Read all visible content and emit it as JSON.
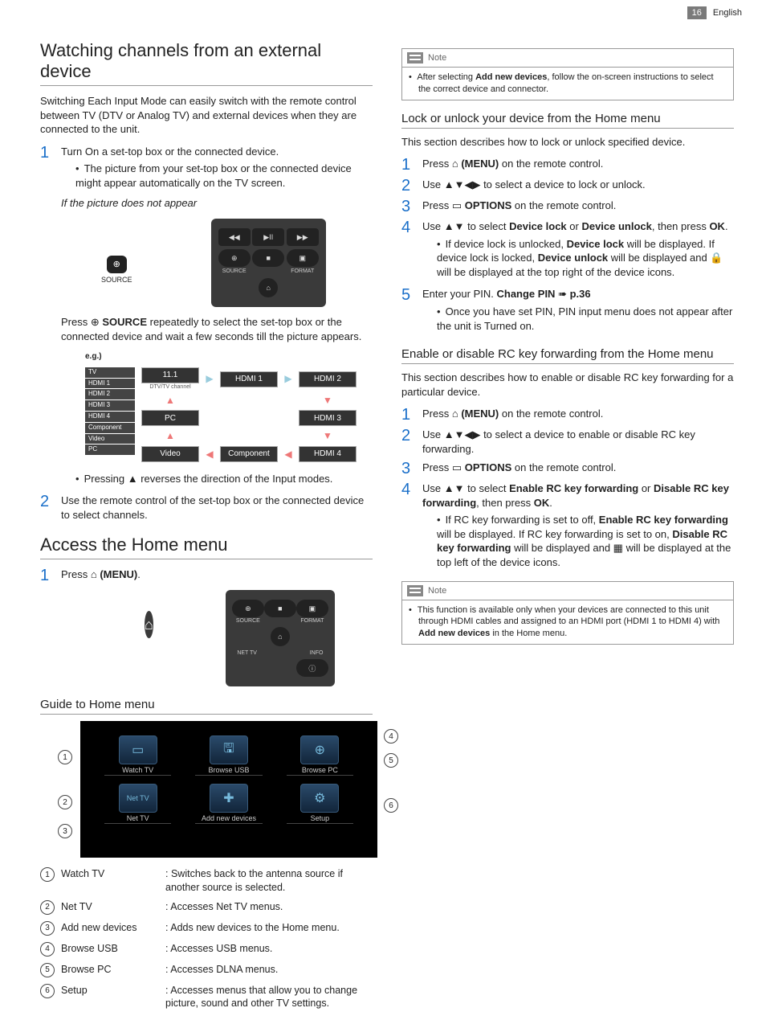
{
  "pageNumber": "16",
  "language": "English",
  "left": {
    "h2a": "Watching channels from an external device",
    "intro": "Switching Each Input Mode can easily switch with the remote control between TV (DTV or Analog TV) and external devices when they are connected to the unit.",
    "step1": "Turn On a set-top box or the connected device.",
    "step1sub": "The picture from your set-top box or the connected device might appear automatically on the TV screen.",
    "noAppear": "If the picture does not appear",
    "remoteBtns": {
      "rew": "◀◀",
      "play": "▶II",
      "ff": "▶▶",
      "source": "SOURCE",
      "stop": "■",
      "format": "FORMAT",
      "home": "⌂",
      "sourceBelow": "SOURCE"
    },
    "pressSource_a": "Press ",
    "pressSource_icon": "⊕",
    "pressSource_b_strong": "SOURCE",
    "pressSource_c": " repeatedly to select the set-top box or the connected device and wait a few seconds till the picture appears.",
    "eg": "e.g.)",
    "inputList": [
      "TV",
      "HDMI 1",
      "HDMI 2",
      "HDMI 3",
      "HDMI 4",
      "Component",
      "Video",
      "PC"
    ],
    "flow": {
      "r1": [
        "11.1",
        "HDMI 1",
        "HDMI 2"
      ],
      "r1sub": "DTV/TV channel",
      "r2": [
        "PC",
        "",
        "HDMI 3"
      ],
      "r3": [
        "Video",
        "Component",
        "HDMI 4"
      ]
    },
    "reverse": "Pressing ▲ reverses the direction of the Input modes.",
    "step2": "Use the remote control of the set-top box or the connected device to select channels.",
    "h2b": "Access the Home menu",
    "home1_a": "Press ",
    "home1_b_strong": "(MENU)",
    "home1_c": ".",
    "remote2": {
      "source": "SOURCE",
      "stop": "■",
      "format": "FORMAT",
      "nettv": "NET TV",
      "info": "INFO",
      "home": "⌂"
    },
    "guideH3": "Guide to Home menu",
    "homeCells": [
      "Watch TV",
      "Browse USB",
      "Browse PC",
      "Net TV",
      "Add new devices",
      "Setup"
    ],
    "homeIcons": [
      "▭",
      "🖫",
      "⊕",
      "Net TV",
      "✚",
      "⚙"
    ],
    "callouts": [
      "1",
      "2",
      "3",
      "4",
      "5",
      "6"
    ],
    "legend": [
      {
        "n": "1",
        "name": "Watch TV",
        "desc": "Switches back to the antenna source if another source is selected."
      },
      {
        "n": "2",
        "name": "Net TV",
        "desc": "Accesses Net TV menus."
      },
      {
        "n": "3",
        "name": "Add new devices",
        "desc": "Adds new devices to the Home menu."
      },
      {
        "n": "4",
        "name": "Browse USB",
        "desc": "Accesses USB menus."
      },
      {
        "n": "5",
        "name": "Browse PC",
        "desc": "Accesses DLNA menus."
      },
      {
        "n": "6",
        "name": "Setup",
        "desc": "Accesses menus that allow you to change picture, sound and other TV settings."
      }
    ]
  },
  "right": {
    "noteLabel": "Note",
    "note1_a": "After selecting ",
    "note1_b_strong": "Add new devices",
    "note1_c": ", follow the on-screen instructions to select the correct device and connector.",
    "h3a": "Lock or unlock your device from the Home menu",
    "lockIntro": "This section describes how to lock or unlock specified device.",
    "lock1_a": "Press ",
    "lock1_icon": "⌂",
    "lock1_b_strong": "(MENU)",
    "lock1_c": " on the remote control.",
    "lock2": "Use ▲▼◀▶ to select a device to lock or unlock.",
    "lock3_a": "Press ",
    "lock3_icon": "▭",
    "lock3_b_strong": "OPTIONS",
    "lock3_c": " on the remote control.",
    "lock4_a": "Use ▲▼ to select ",
    "lock4_b": "Device lock",
    "lock4_c": " or ",
    "lock4_d": "Device unlock",
    "lock4_e": ", then press ",
    "lock4_f": "OK",
    "lock4_g": ".",
    "lock4sub_a": "If device lock is unlocked, ",
    "lock4sub_b": "Device lock",
    "lock4sub_c": " will be displayed. If device lock is locked, ",
    "lock4sub_d": "Device unlock",
    "lock4sub_e": " will be displayed and ",
    "lock4sub_icon": "🔒",
    "lock4sub_f": " will be displayed at the top right of the device icons.",
    "lock5_a": "Enter your PIN. ",
    "lock5_b": "Change PIN",
    "lock5_c": " ➠ ",
    "lock5_d": "p.36",
    "lock5sub": "Once you have set PIN, PIN input menu does not appear after the unit is Turned on.",
    "h3b": "Enable or disable RC key forwarding from the Home menu",
    "rcIntro": "This section describes how to enable or disable RC key forwarding for a particular device.",
    "rc1_a": "Press ",
    "rc1_icon": "⌂",
    "rc1_b_strong": "(MENU)",
    "rc1_c": " on the remote control.",
    "rc2": "Use ▲▼◀▶ to select a device to enable or disable RC key forwarding.",
    "rc3_a": "Press ",
    "rc3_icon": "▭",
    "rc3_b_strong": "OPTIONS",
    "rc3_c": " on the remote control.",
    "rc4_a": "Use ▲▼ to select ",
    "rc4_b": "Enable RC key forwarding",
    "rc4_c": " or ",
    "rc4_d": "Disable RC key forwarding",
    "rc4_e": ", then press ",
    "rc4_f": "OK",
    "rc4_g": ".",
    "rc4sub_a": "If RC key forwarding is set to off, ",
    "rc4sub_b": "Enable RC key forwarding",
    "rc4sub_c": " will be displayed. If RC key forwarding is set to on, ",
    "rc4sub_d": "Disable RC key forwarding",
    "rc4sub_e": " will be displayed and ",
    "rc4sub_icon": "▦",
    "rc4sub_f": " will be displayed at the top left of the device icons.",
    "note2_a": "This function is available only when your devices are connected to this unit through HDMI cables and assigned to an HDMI port (HDMI 1 to HDMI 4) with ",
    "note2_b_strong": "Add new devices",
    "note2_c": " in the Home menu."
  }
}
